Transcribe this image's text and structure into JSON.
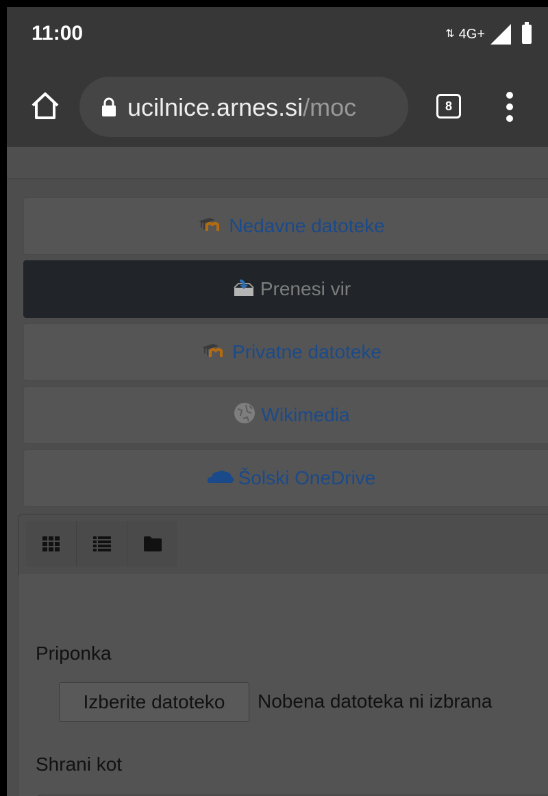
{
  "status_bar": {
    "time": "11:00",
    "network": "4G+",
    "data_arrows": "⇅"
  },
  "browser": {
    "url_domain": "ucilnice.arnes.si",
    "url_path": "/moc",
    "tab_count": "8"
  },
  "repositories": [
    {
      "label": "Nedavne datoteke",
      "icon": "moodle-icon",
      "active": false
    },
    {
      "label": "Prenesi vir",
      "icon": "upload-icon",
      "active": true
    },
    {
      "label": "Privatne datoteke",
      "icon": "moodle-icon",
      "active": false
    },
    {
      "label": "Wikimedia",
      "icon": "wikimedia-icon",
      "active": false
    },
    {
      "label": "Šolski OneDrive",
      "icon": "onedrive-icon",
      "active": false
    }
  ],
  "view_modes": [
    "grid-view-icon",
    "list-view-icon",
    "folder-view-icon"
  ],
  "form": {
    "attachment_label": "Priponka",
    "choose_file_button": "Izberite datoteko",
    "no_file_text": "Nobena datoteka ni izbrana",
    "save_as_label": "Shrani kot"
  },
  "colors": {
    "link": "#1b4a8a",
    "active_bg": "#212529",
    "moodle_orange": "#b36b12"
  }
}
